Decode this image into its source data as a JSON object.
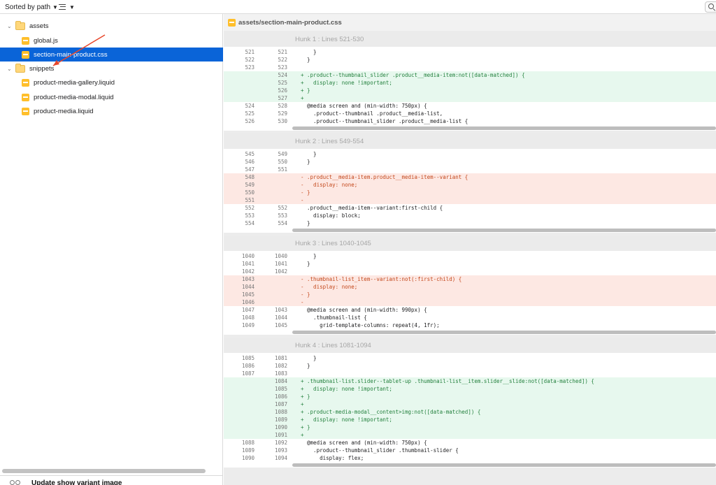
{
  "toolbar": {
    "sort_label": "Sorted by path",
    "sort_chevron": "chevron-down-icon",
    "view_icon": "list-view-icon",
    "search_icon": "search-icon"
  },
  "sidebar": {
    "tree": [
      {
        "type": "folder",
        "label": "assets",
        "expanded": true
      },
      {
        "type": "file",
        "label": "global.js",
        "selected": false
      },
      {
        "type": "file",
        "label": "section-main-product.css",
        "selected": true
      },
      {
        "type": "folder",
        "label": "snippets",
        "expanded": true
      },
      {
        "type": "file",
        "label": "product-media-gallery.liquid",
        "selected": false
      },
      {
        "type": "file",
        "label": "product-media-modal.liquid",
        "selected": false
      },
      {
        "type": "file",
        "label": "product-media.liquid",
        "selected": false
      }
    ],
    "commit_message": "Update show variant image"
  },
  "diff": {
    "file_path": "assets/section-main-product.css",
    "colors": {
      "added_bg": "#e7f8ee",
      "added_text": "#23803d",
      "removed_bg": "#fde8e3",
      "removed_text": "#c4481c",
      "selection": "#0a64d8"
    },
    "hunks": [
      {
        "title": "Hunk 1 : Lines 521-530",
        "lines": [
          {
            "old": "521",
            "new": "521",
            "type": "ctx",
            "text": "    }"
          },
          {
            "old": "522",
            "new": "522",
            "type": "ctx",
            "text": "  }"
          },
          {
            "old": "523",
            "new": "523",
            "type": "ctx",
            "text": ""
          },
          {
            "old": "",
            "new": "524",
            "type": "add",
            "text": "+ .product--thumbnail_slider .product__media-item:not([data-matched]) {"
          },
          {
            "old": "",
            "new": "525",
            "type": "add",
            "text": "+   display: none !important;"
          },
          {
            "old": "",
            "new": "526",
            "type": "add",
            "text": "+ }"
          },
          {
            "old": "",
            "new": "527",
            "type": "add",
            "text": "+"
          },
          {
            "old": "524",
            "new": "528",
            "type": "ctx",
            "text": "  @media screen and (min-width: 750px) {"
          },
          {
            "old": "525",
            "new": "529",
            "type": "ctx",
            "text": "    .product--thumbnail .product__media-list,"
          },
          {
            "old": "526",
            "new": "530",
            "type": "ctx",
            "text": "    .product--thumbnail_slider .product__media-list {"
          }
        ]
      },
      {
        "title": "Hunk 2 : Lines 549-554",
        "lines": [
          {
            "old": "545",
            "new": "549",
            "type": "ctx",
            "text": "    }"
          },
          {
            "old": "546",
            "new": "550",
            "type": "ctx",
            "text": "  }"
          },
          {
            "old": "547",
            "new": "551",
            "type": "ctx",
            "text": ""
          },
          {
            "old": "548",
            "new": "",
            "type": "del",
            "text": "- .product__media-item.product__media-item--variant {"
          },
          {
            "old": "549",
            "new": "",
            "type": "del",
            "text": "-   display: none;"
          },
          {
            "old": "550",
            "new": "",
            "type": "del",
            "text": "- }"
          },
          {
            "old": "551",
            "new": "",
            "type": "del",
            "text": "-"
          },
          {
            "old": "552",
            "new": "552",
            "type": "ctx",
            "text": "  .product__media-item--variant:first-child {"
          },
          {
            "old": "553",
            "new": "553",
            "type": "ctx",
            "text": "    display: block;"
          },
          {
            "old": "554",
            "new": "554",
            "type": "ctx",
            "text": "  }"
          }
        ]
      },
      {
        "title": "Hunk 3 : Lines 1040-1045",
        "lines": [
          {
            "old": "1040",
            "new": "1040",
            "type": "ctx",
            "text": "    }"
          },
          {
            "old": "1041",
            "new": "1041",
            "type": "ctx",
            "text": "  }"
          },
          {
            "old": "1042",
            "new": "1042",
            "type": "ctx",
            "text": ""
          },
          {
            "old": "1043",
            "new": "",
            "type": "del",
            "text": "- .thumbnail-list_item--variant:not(:first-child) {"
          },
          {
            "old": "1044",
            "new": "",
            "type": "del",
            "text": "-   display: none;"
          },
          {
            "old": "1045",
            "new": "",
            "type": "del",
            "text": "- }"
          },
          {
            "old": "1046",
            "new": "",
            "type": "del",
            "text": "-"
          },
          {
            "old": "1047",
            "new": "1043",
            "type": "ctx",
            "text": "  @media screen and (min-width: 990px) {"
          },
          {
            "old": "1048",
            "new": "1044",
            "type": "ctx",
            "text": "    .thumbnail-list {"
          },
          {
            "old": "1049",
            "new": "1045",
            "type": "ctx",
            "text": "      grid-template-columns: repeat(4, 1fr);"
          }
        ]
      },
      {
        "title": "Hunk 4 : Lines 1081-1094",
        "lines": [
          {
            "old": "1085",
            "new": "1081",
            "type": "ctx",
            "text": "    }"
          },
          {
            "old": "1086",
            "new": "1082",
            "type": "ctx",
            "text": "  }"
          },
          {
            "old": "1087",
            "new": "1083",
            "type": "ctx",
            "text": ""
          },
          {
            "old": "",
            "new": "1084",
            "type": "add",
            "text": "+ .thumbnail-list.slider--tablet-up .thumbnail-list__item.slider__slide:not([data-matched]) {"
          },
          {
            "old": "",
            "new": "1085",
            "type": "add",
            "text": "+   display: none !important;"
          },
          {
            "old": "",
            "new": "1086",
            "type": "add",
            "text": "+ }"
          },
          {
            "old": "",
            "new": "1087",
            "type": "add",
            "text": "+"
          },
          {
            "old": "",
            "new": "1088",
            "type": "add",
            "text": "+ .product-media-modal__content>img:not([data-matched]) {"
          },
          {
            "old": "",
            "new": "1089",
            "type": "add",
            "text": "+   display: none !important;"
          },
          {
            "old": "",
            "new": "1090",
            "type": "add",
            "text": "+ }"
          },
          {
            "old": "",
            "new": "1091",
            "type": "add",
            "text": "+"
          },
          {
            "old": "1088",
            "new": "1092",
            "type": "ctx",
            "text": "  @media screen and (min-width: 750px) {"
          },
          {
            "old": "1089",
            "new": "1093",
            "type": "ctx",
            "text": "    .product--thumbnail_slider .thumbnail-slider {"
          },
          {
            "old": "1090",
            "new": "1094",
            "type": "ctx",
            "text": "      display: flex;"
          }
        ]
      }
    ]
  }
}
